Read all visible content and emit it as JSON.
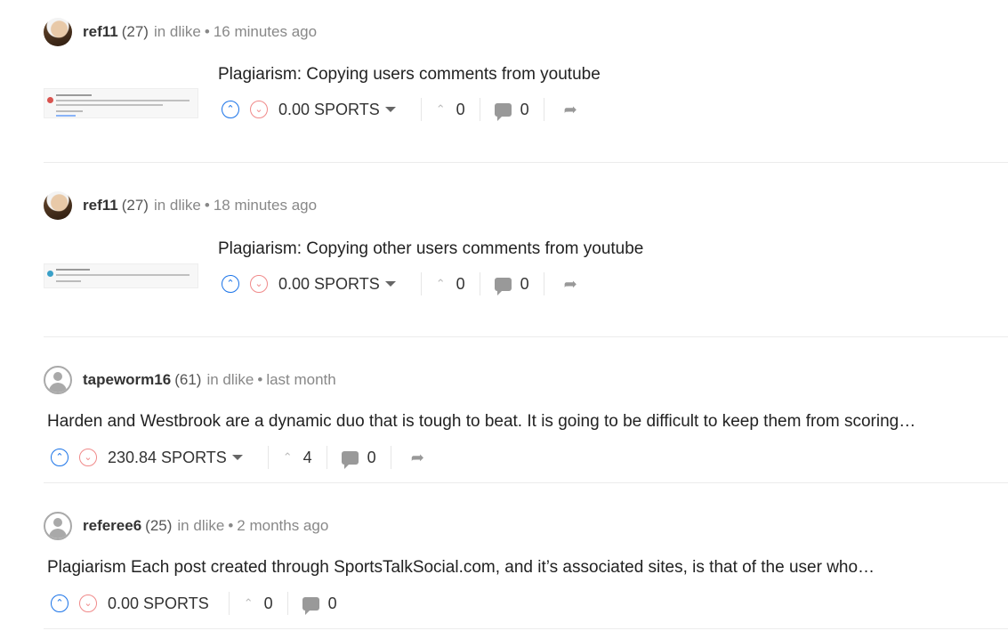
{
  "posts": [
    {
      "author": "ref11",
      "rep": "(27)",
      "community": "in dlike",
      "sep": "•",
      "time": "16 minutes ago",
      "title": "Plagiarism: Copying users comments from youtube",
      "payout": "0.00 SPORTS",
      "votes": "0",
      "comments": "0",
      "avatar": "user-photo",
      "has_thumbnail": true,
      "has_dropdown": true,
      "has_reblog": true
    },
    {
      "author": "ref11",
      "rep": "(27)",
      "community": "in dlike",
      "sep": "•",
      "time": "18 minutes ago",
      "title": "Plagiarism: Copying other users comments from youtube",
      "payout": "0.00 SPORTS",
      "votes": "0",
      "comments": "0",
      "avatar": "user-photo",
      "has_thumbnail": true,
      "has_dropdown": true,
      "has_reblog": true
    },
    {
      "author": "tapeworm16",
      "rep": "(61)",
      "community": "in dlike",
      "sep": "•",
      "time": "last month",
      "title": "Harden and Westbrook are a dynamic duo that is tough to beat. It is going to be difficult to keep them from scoring…",
      "payout": "230.84 SPORTS",
      "votes": "4",
      "comments": "0",
      "avatar": "default-avatar",
      "has_thumbnail": false,
      "has_dropdown": true,
      "has_reblog": true
    },
    {
      "author": "referee6",
      "rep": "(25)",
      "community": "in dlike",
      "sep": "•",
      "time": "2 months ago",
      "title": "Plagiarism Each post created through SportsTalkSocial.com, and it’s associated sites, is that of the user who…",
      "payout": "0.00 SPORTS",
      "votes": "0",
      "comments": "0",
      "avatar": "default-avatar",
      "has_thumbnail": false,
      "has_dropdown": false,
      "has_reblog": false
    }
  ],
  "icons": {
    "upvote": "upvote-chevron-icon",
    "downvote": "downvote-chevron-icon",
    "payout_dropdown": "caret-down-icon",
    "vote_count": "small-up-chevron-icon",
    "comments": "speech-bubble-icon",
    "reblog": "reblog-arrow-icon"
  },
  "colors": {
    "upvote": "#1a73e8",
    "downvote": "#f08a8a",
    "separator": "#ececec"
  }
}
